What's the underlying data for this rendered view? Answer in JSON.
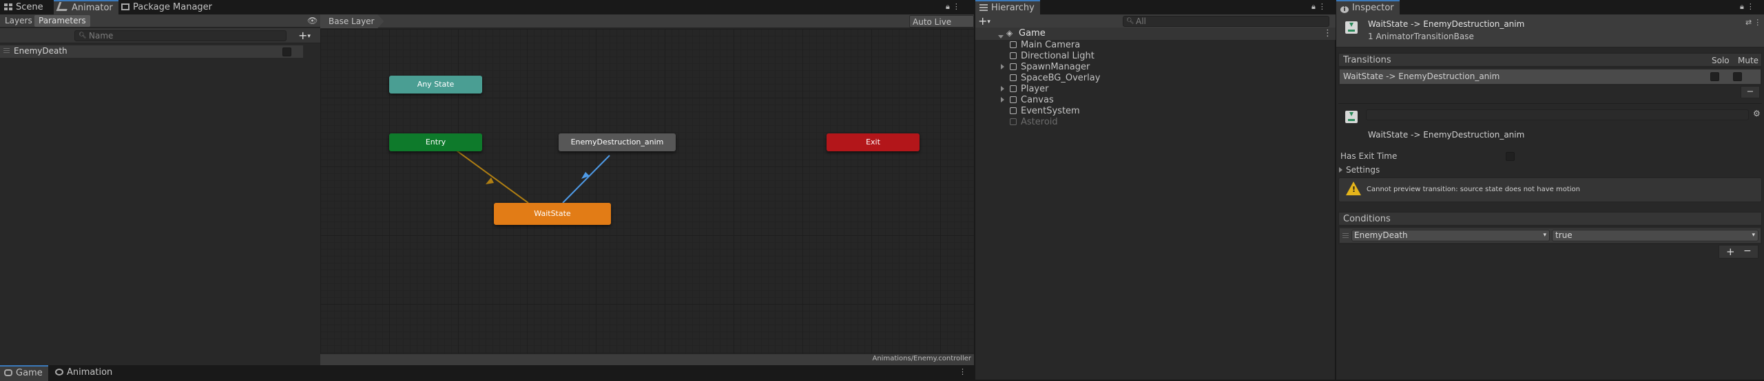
{
  "left_tabs": [
    {
      "label": "Scene",
      "icon": "scene-grid-icon"
    },
    {
      "label": "Animator",
      "icon": "animator-icon"
    },
    {
      "label": "Package Manager",
      "icon": "package-icon"
    }
  ],
  "animator": {
    "subtabs": [
      "Layers",
      "Parameters"
    ],
    "search_placeholder": "Name",
    "parameters": [
      {
        "name": "EnemyDeath",
        "type": "bool",
        "value": false
      }
    ],
    "breadcrumb": "Base Layer",
    "auto_live_link": "Auto Live Link",
    "footer_path": "Animations/Enemy.controller",
    "states": {
      "any_state": "Any State",
      "entry": "Entry",
      "enemy_destruction": "EnemyDestruction_anim",
      "exit": "Exit",
      "wait_state": "WaitState"
    },
    "colors": {
      "any": "#4a9e93",
      "entry": "#0e7a2b",
      "default": "#e27c16",
      "exit": "#b3161a",
      "state": "#575757",
      "transition_selected": "#4f9be8",
      "transition_entry": "#b07f13"
    }
  },
  "bottom_tabs": [
    {
      "label": "Game",
      "icon": "game-icon"
    },
    {
      "label": "Animation",
      "icon": "animation-icon"
    }
  ],
  "hierarchy": {
    "tab": "Hierarchy",
    "search_placeholder": "All",
    "scene": "Game",
    "items": [
      {
        "label": "Main Camera",
        "expandable": false,
        "dim": false
      },
      {
        "label": "Directional Light",
        "expandable": false,
        "dim": false
      },
      {
        "label": "SpawnManager",
        "expandable": true,
        "dim": false
      },
      {
        "label": "SpaceBG_Overlay",
        "expandable": false,
        "dim": false
      },
      {
        "label": "Player",
        "expandable": true,
        "dim": false
      },
      {
        "label": "Canvas",
        "expandable": true,
        "dim": false
      },
      {
        "label": "EventSystem",
        "expandable": false,
        "dim": false
      },
      {
        "label": "Asteroid",
        "expandable": false,
        "dim": true
      }
    ]
  },
  "inspector": {
    "tab": "Inspector",
    "title": "WaitState -> EnemyDestruction_anim",
    "subtitle": "1 AnimatorTransitionBase",
    "transitions_header": "Transitions",
    "solo": "Solo",
    "mute": "Mute",
    "transition_row": "WaitState -> EnemyDestruction_anim",
    "minus": "−",
    "transition_label": "WaitState -> EnemyDestruction_anim",
    "has_exit_time": "Has Exit Time",
    "settings": "Settings",
    "warning": "Cannot preview transition: source state does not have motion",
    "conditions_header": "Conditions",
    "condition": {
      "parameter": "EnemyDeath",
      "value": "true"
    },
    "plus": "+",
    "minus2": "−"
  }
}
